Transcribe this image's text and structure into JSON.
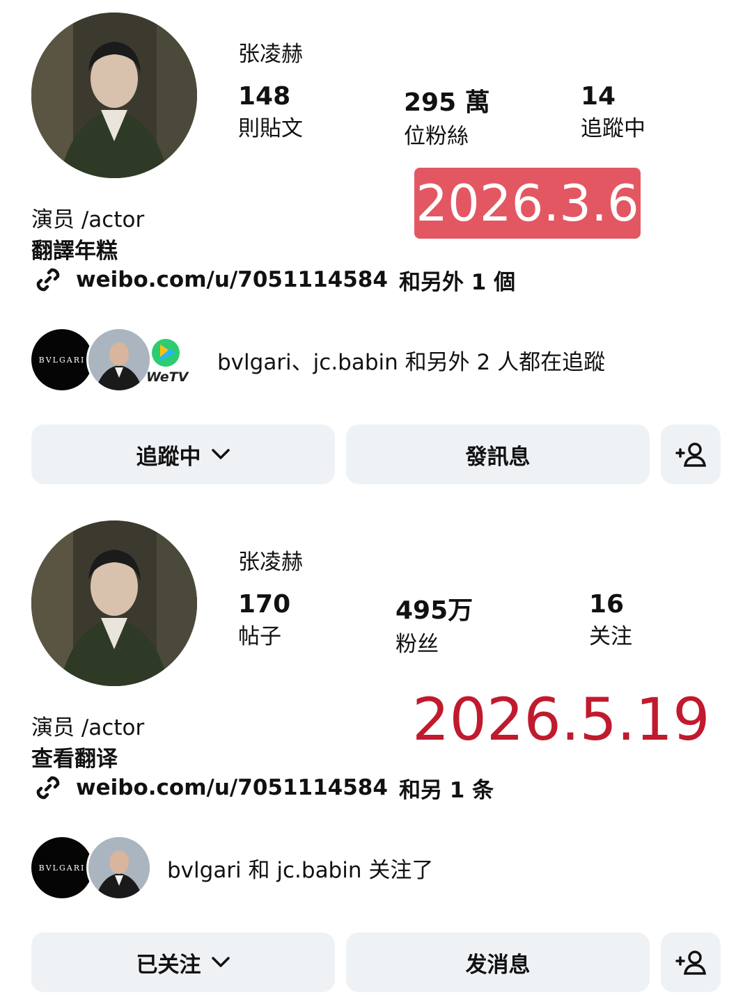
{
  "colors": {
    "button_bg": "#eff2f5",
    "date_badge_bg": "#e35763",
    "date_text_red": "#c01a2e"
  },
  "profile_before": {
    "username": "张凌赫",
    "stats": [
      {
        "value": "148",
        "label": "則貼文"
      },
      {
        "value": "295 萬",
        "label": "位粉絲"
      },
      {
        "value": "14",
        "label": "追蹤中"
      }
    ],
    "date_badge": "2026.3.6",
    "bio_line1": "演员 /actor",
    "bio_translate": "翻譯年糕",
    "link_url": "weibo.com/u/7051114584",
    "link_more": "和另外 1 個",
    "mutual_followers_text": "bvlgari、jc.babin 和另外 2 人都在追蹤",
    "mutual_avatar_bvlgari": "BVLGARI",
    "mutual_avatar_wetv": "WeTV",
    "buttons": {
      "follow": "追蹤中",
      "message": "發訊息"
    }
  },
  "profile_after": {
    "username": "张凌赫",
    "stats": [
      {
        "value": "170",
        "label": "帖子"
      },
      {
        "value": "495万",
        "label": "粉丝"
      },
      {
        "value": "16",
        "label": "关注"
      }
    ],
    "date_text": "2026.5.19",
    "bio_line1": "演员 /actor",
    "bio_translate": "查看翻译",
    "link_url": "weibo.com/u/7051114584",
    "link_more": "和另 1 条",
    "mutual_followers_text": "bvlgari 和 jc.babin 关注了",
    "mutual_avatar_bvlgari": "BVLGARI",
    "buttons": {
      "follow": "已关注",
      "message": "发消息"
    }
  },
  "icons": {
    "link": "link-icon",
    "chevron": "chevron-down-icon",
    "add_person": "add-person-icon",
    "avatar": "avatar",
    "wetv": "wetv-logo-icon"
  }
}
